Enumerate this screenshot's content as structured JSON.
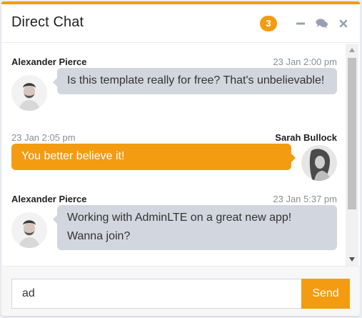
{
  "header": {
    "title": "Direct Chat",
    "badge_count": "3",
    "tools": [
      "minus-icon",
      "comments-icon",
      "close-icon"
    ]
  },
  "messages": [
    {
      "side": "left",
      "name": "Alexander Pierce",
      "timestamp": "23 Jan 2:00 pm",
      "text": "Is this template really for free? That's unbelievable!"
    },
    {
      "side": "right",
      "name": "Sarah Bullock",
      "timestamp": "23 Jan 2:05 pm",
      "text": "You better believe it!"
    },
    {
      "side": "left",
      "name": "Alexander Pierce",
      "timestamp": "23 Jan 5:37 pm",
      "text": "Working with AdminLTE on a great new app! Wanna join?"
    }
  ],
  "footer": {
    "input_value": "ad",
    "send_label": "Send"
  },
  "colors": {
    "accent": "#f39c12",
    "bubble_left": "#d2d6de"
  }
}
